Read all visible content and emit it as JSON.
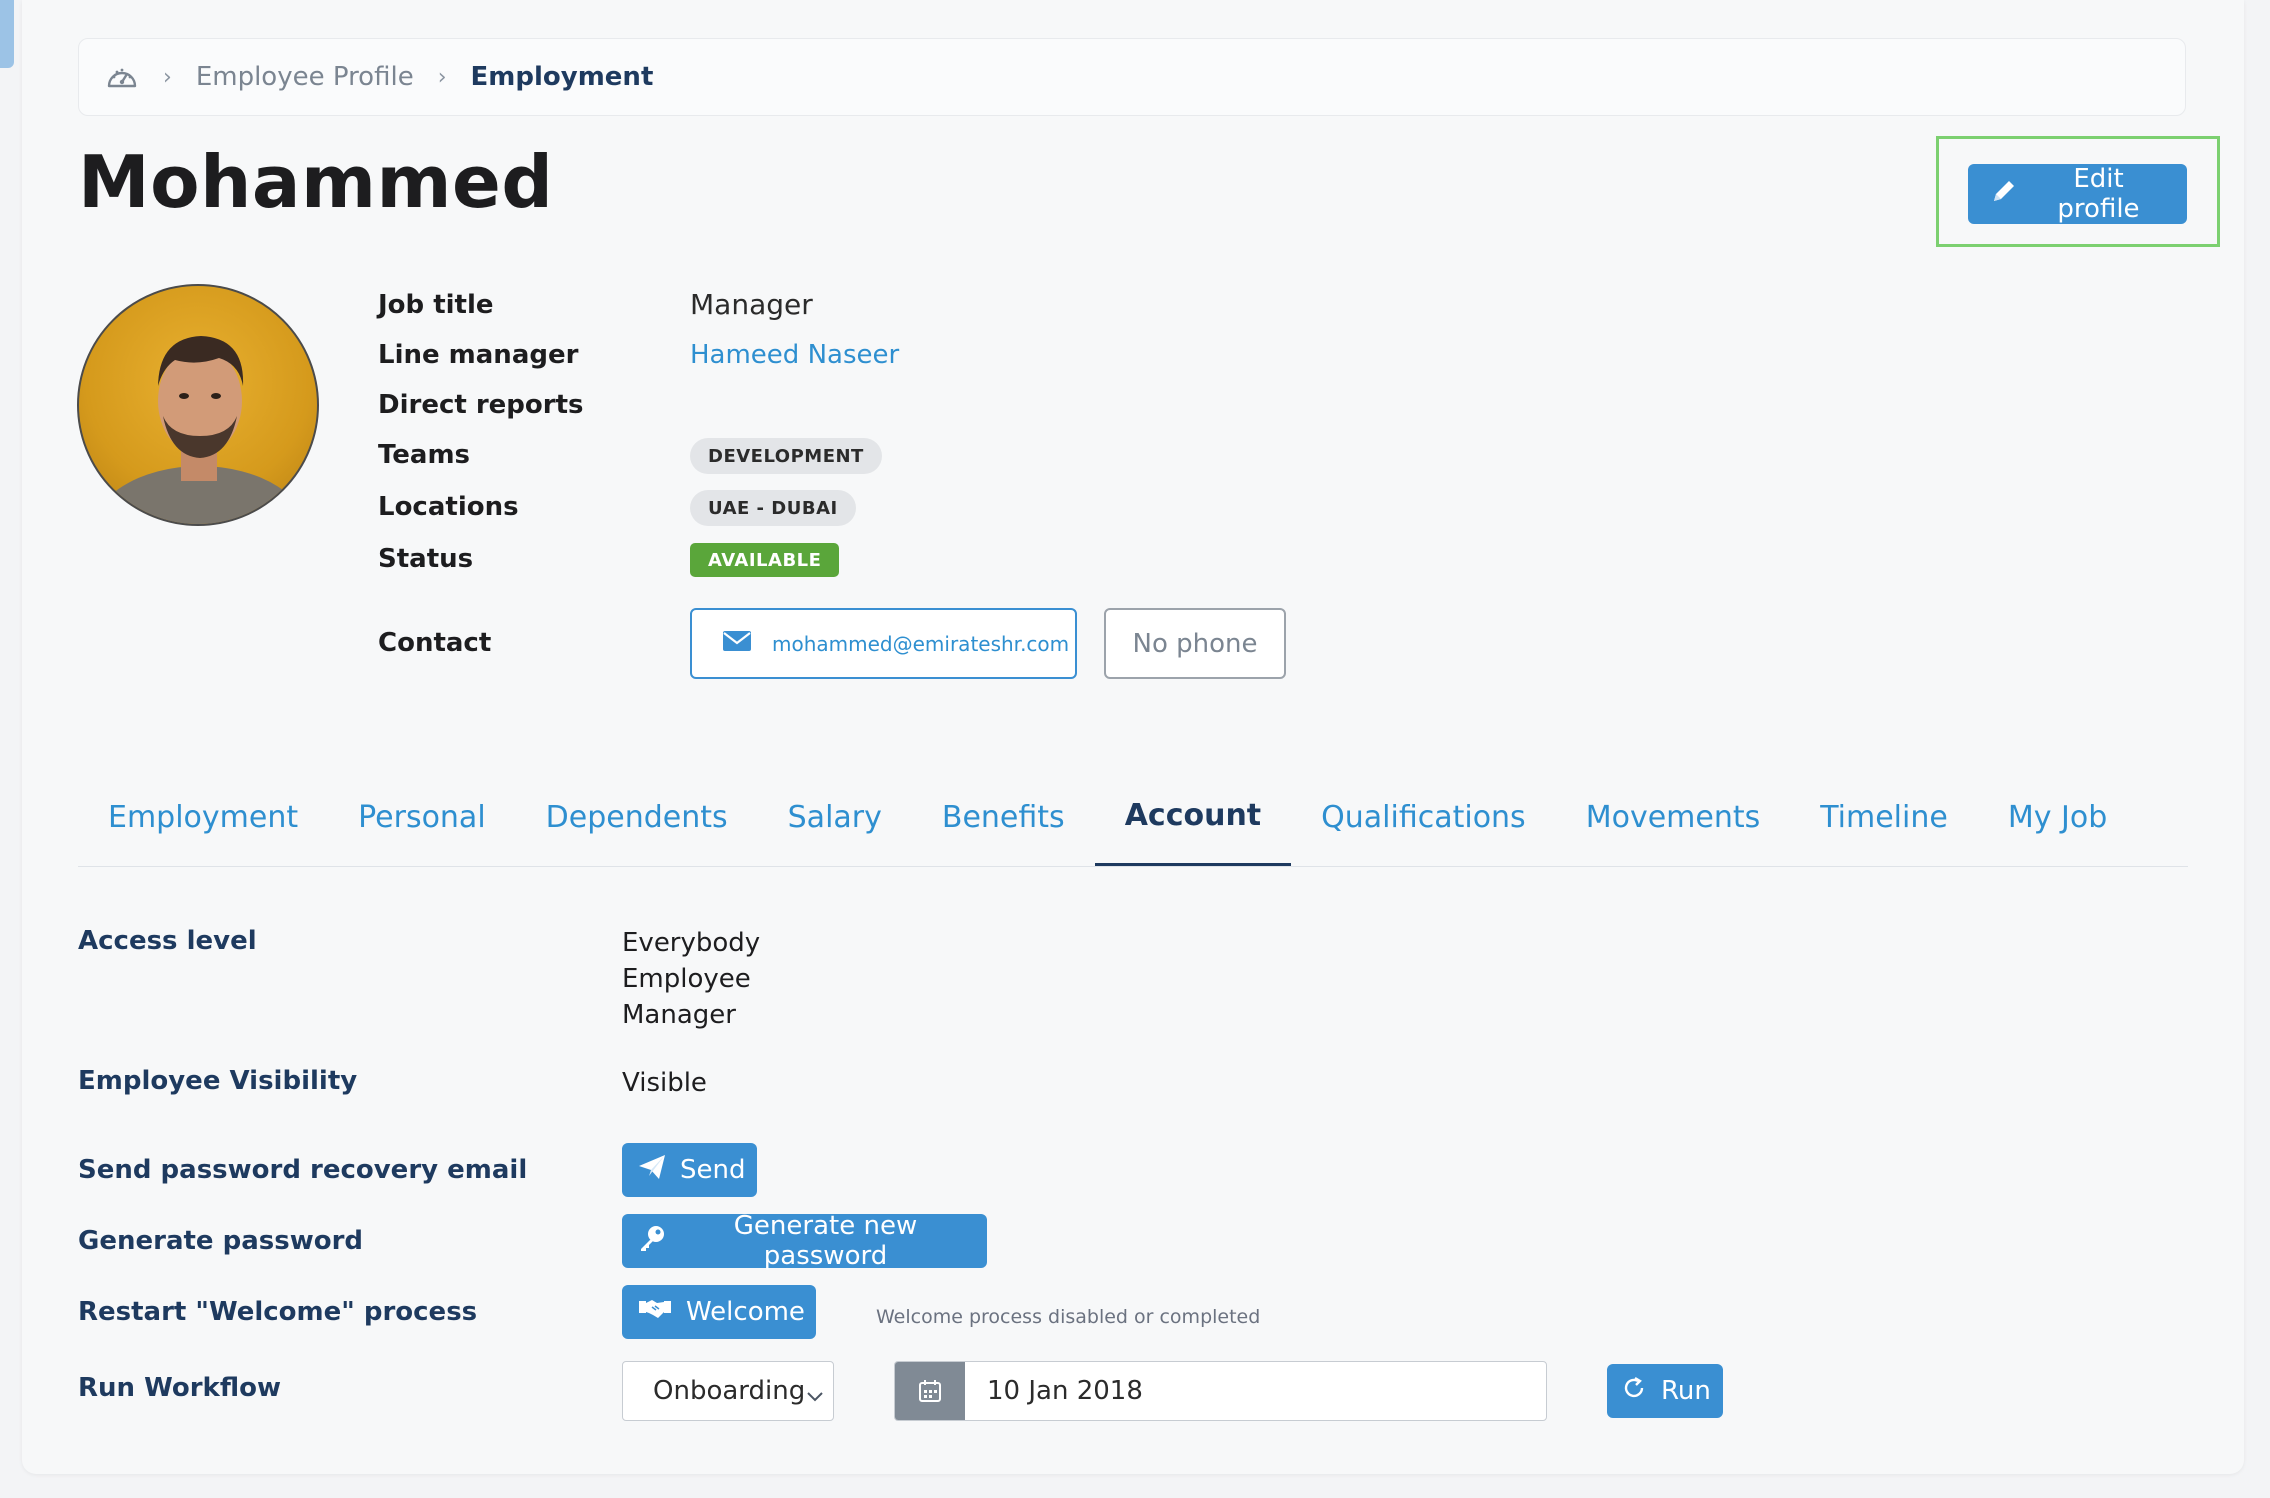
{
  "breadcrumb": {
    "home_icon": "dashboard-gauge-icon",
    "items": [
      "Employee Profile",
      "Employment"
    ]
  },
  "profile": {
    "name": "Mohammed",
    "edit_label": "Edit profile",
    "fields": {
      "job_title_label": "Job title",
      "job_title": "Manager",
      "line_manager_label": "Line manager",
      "line_manager": "Hameed Naseer",
      "direct_reports_label": "Direct reports",
      "teams_label": "Teams",
      "team": "DEVELOPMENT",
      "locations_label": "Locations",
      "location": "UAE - DUBAI",
      "status_label": "Status",
      "status": "AVAILABLE",
      "contact_label": "Contact",
      "email": "mohammed@emirateshr.com",
      "phone": "No phone"
    }
  },
  "tabs": [
    "Employment",
    "Personal",
    "Dependents",
    "Salary",
    "Benefits",
    "Account",
    "Qualifications",
    "Movements",
    "Timeline",
    "My Job"
  ],
  "active_tab": "Account",
  "account": {
    "access_level_label": "Access level",
    "access_levels": [
      "Everybody",
      "Employee",
      "Manager"
    ],
    "visibility_label": "Employee Visibility",
    "visibility": "Visible",
    "recovery_label": "Send password recovery email",
    "send_label": "Send",
    "generate_label": "Generate password",
    "generate_btn": "Generate new password",
    "welcome_label": "Restart \"Welcome\" process",
    "welcome_btn": "Welcome",
    "welcome_note": "Welcome process disabled or completed",
    "workflow_label": "Run Workflow",
    "workflow_selected": "Onboarding",
    "workflow_date": "10 Jan 2018",
    "run_label": "Run"
  },
  "colors": {
    "accent": "#3a8fd2",
    "navy": "#1e3a5f",
    "status_green": "#5aa63a",
    "highlight_frame": "#7cd070"
  }
}
